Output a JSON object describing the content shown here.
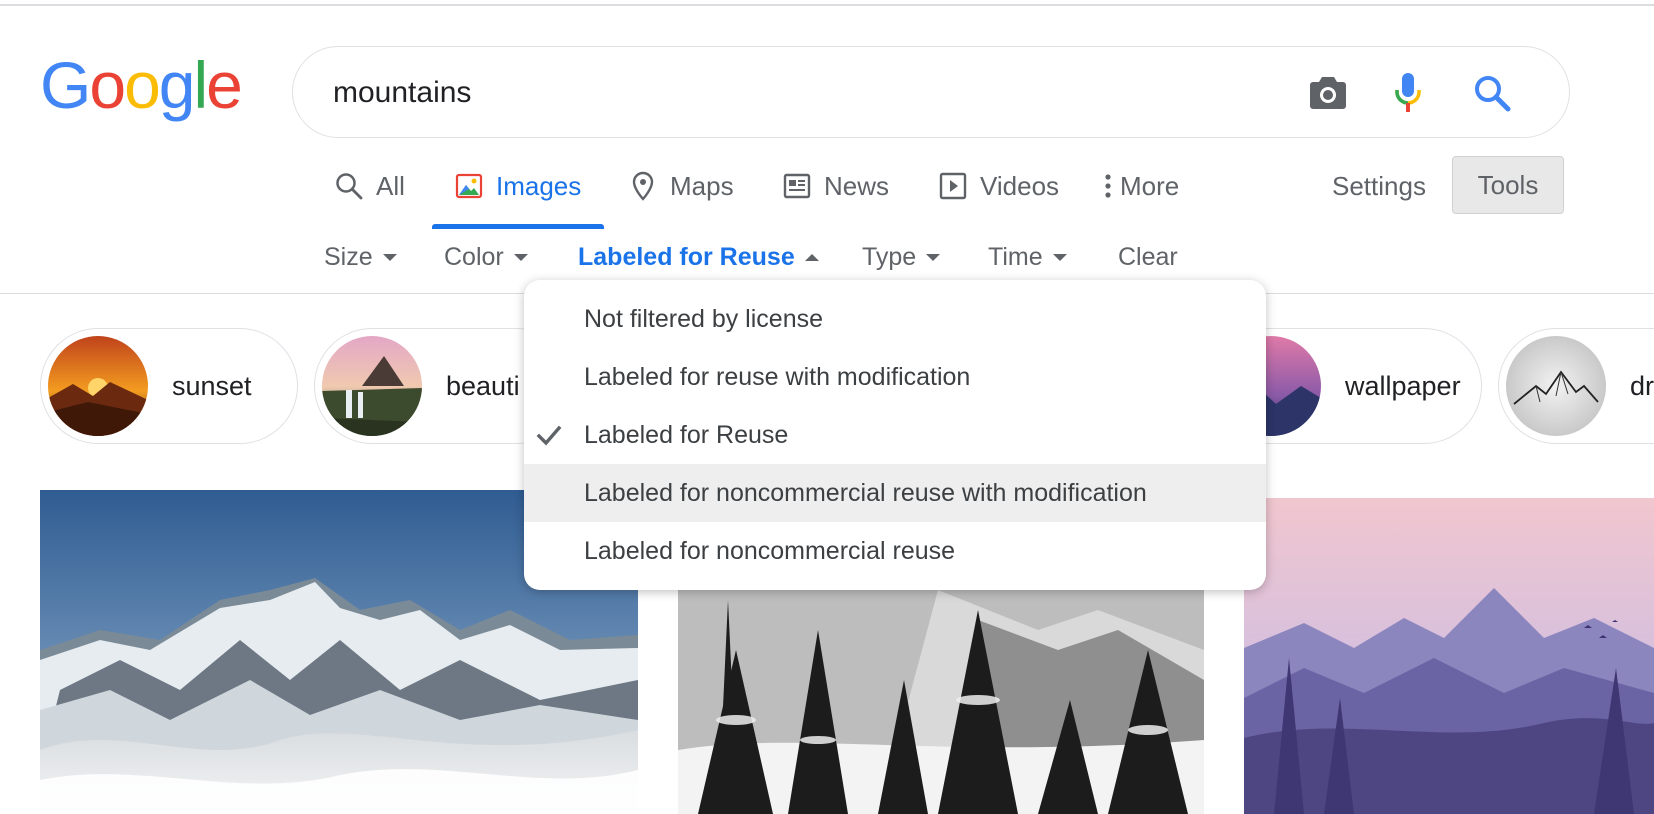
{
  "logo": {
    "letters": [
      "G",
      "o",
      "o",
      "g",
      "l",
      "e"
    ],
    "colors": [
      "#4285f4",
      "#ea4335",
      "#fbbc05",
      "#4285f4",
      "#34a853",
      "#ea4335"
    ]
  },
  "search": {
    "query": "mountains",
    "icons": [
      "camera-icon",
      "microphone-icon",
      "search-icon"
    ]
  },
  "nav": {
    "tabs": [
      {
        "label": "All",
        "icon": "search-icon"
      },
      {
        "label": "Images",
        "icon": "image-icon",
        "active": true
      },
      {
        "label": "Maps",
        "icon": "map-pin-icon"
      },
      {
        "label": "News",
        "icon": "newspaper-icon"
      },
      {
        "label": "Videos",
        "icon": "play-icon"
      },
      {
        "label": "More",
        "icon": "more-vertical-icon"
      }
    ],
    "settings": "Settings",
    "tools": "Tools"
  },
  "filters": {
    "items": [
      "Size",
      "Color",
      "Labeled for Reuse",
      "Type",
      "Time"
    ],
    "active": "Labeled for Reuse",
    "clear": "Clear"
  },
  "license_menu": {
    "options": [
      "Not filtered by license",
      "Labeled for reuse with modification",
      "Labeled for Reuse",
      "Labeled for noncommercial reuse with modification",
      "Labeled for noncommercial reuse"
    ],
    "selected": "Labeled for Reuse",
    "hovered": "Labeled for noncommercial reuse with modification"
  },
  "chips": [
    {
      "label": "sunset"
    },
    {
      "label": "beauti"
    },
    {
      "label": "wallpaper"
    },
    {
      "label": "dr"
    }
  ],
  "colors": {
    "accent": "#1a73e8",
    "text_primary": "#202124",
    "text_secondary": "#5f6368"
  }
}
